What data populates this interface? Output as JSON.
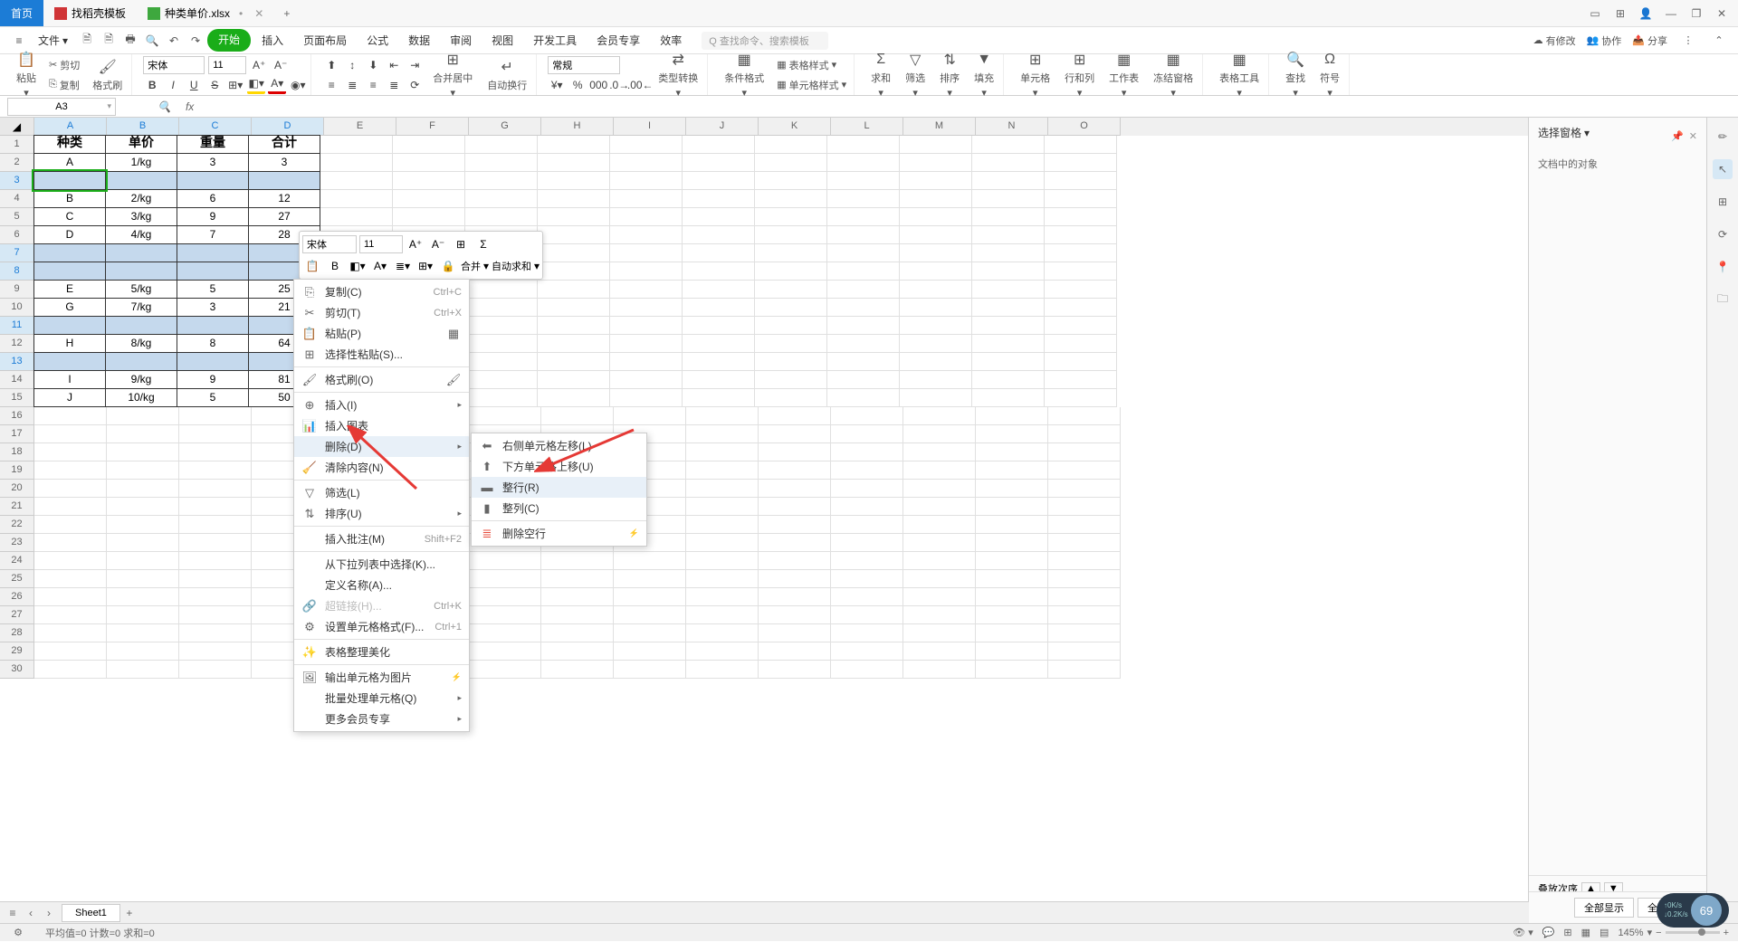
{
  "tabs": {
    "home": "首页",
    "templates": "找稻壳模板",
    "file": "种类单价.xlsx"
  },
  "menu": {
    "file": "文件",
    "items": [
      "开始",
      "插入",
      "页面布局",
      "公式",
      "数据",
      "审阅",
      "视图",
      "开发工具",
      "会员专享",
      "效率"
    ],
    "search": "Q 查找命令、搜索模板"
  },
  "right_tools": {
    "modified": "有修改",
    "collaborate": "协作",
    "share": "分享"
  },
  "ribbon": {
    "paste": "粘贴",
    "cut": "剪切",
    "copy": "复制",
    "format_painter": "格式刷",
    "font_name": "宋体",
    "font_size": "11",
    "merge_center": "合并居中",
    "wrap": "自动换行",
    "number_format": "常规",
    "type_convert": "类型转换",
    "cond_format": "条件格式",
    "table_format": "表格样式",
    "cell_format": "单元格样式",
    "sum": "求和",
    "filter": "筛选",
    "sort": "排序",
    "fill": "填充",
    "cell": "单元格",
    "rows_cols": "行和列",
    "sheet": "工作表",
    "freeze": "冻结窗格",
    "table_tools": "表格工具",
    "find": "查找",
    "symbol": "符号"
  },
  "name_box": "A3",
  "columns": [
    "A",
    "B",
    "C",
    "D",
    "E",
    "F",
    "G",
    "H",
    "I",
    "J",
    "K",
    "L",
    "M",
    "N",
    "O"
  ],
  "table": {
    "headers": [
      "种类",
      "单价",
      "重量",
      "合计"
    ],
    "rows": [
      [
        "A",
        "1/kg",
        "3",
        "3"
      ],
      [
        "",
        "",
        "",
        ""
      ],
      [
        "B",
        "2/kg",
        "6",
        "12"
      ],
      [
        "C",
        "3/kg",
        "9",
        "27"
      ],
      [
        "D",
        "4/kg",
        "7",
        "28"
      ],
      [
        "",
        "",
        "",
        ""
      ],
      [
        "",
        "",
        "",
        ""
      ],
      [
        "E",
        "5/kg",
        "5",
        "25"
      ],
      [
        "G",
        "7/kg",
        "3",
        "21"
      ],
      [
        "",
        "",
        "",
        ""
      ],
      [
        "H",
        "8/kg",
        "8",
        "64"
      ],
      [
        "",
        "",
        "",
        ""
      ],
      [
        "I",
        "9/kg",
        "9",
        "81"
      ],
      [
        "J",
        "10/kg",
        "5",
        "50"
      ]
    ]
  },
  "float_tb": {
    "font": "宋体",
    "size": "11",
    "merge": "合并",
    "sum": "自动求和"
  },
  "context_menu": {
    "copy": "复制(C)",
    "cut": "剪切(T)",
    "paste": "粘贴(P)",
    "paste_special": "选择性粘贴(S)...",
    "format_painter": "格式刷(O)",
    "insert": "插入(I)",
    "insert_chart": "插入图表",
    "delete": "删除(D)",
    "clear": "清除内容(N)",
    "filter": "筛选(L)",
    "sort": "排序(U)",
    "insert_comment": "插入批注(M)",
    "from_dropdown": "从下拉列表中选择(K)...",
    "define_name": "定义名称(A)...",
    "hyperlink": "超链接(H)...",
    "cell_format": "设置单元格格式(F)...",
    "format_beautify": "表格整理美化",
    "export_image": "输出单元格为图片",
    "batch_process": "批量处理单元格(Q)",
    "more_member": "更多会员专享",
    "sc_copy": "Ctrl+C",
    "sc_cut": "Ctrl+X",
    "sc_comment": "Shift+F2",
    "sc_hyper": "Ctrl+K",
    "sc_format": "Ctrl+1"
  },
  "delete_submenu": {
    "shift_left": "右侧单元格左移(L)",
    "shift_up": "下方单元格上移(U)",
    "entire_row": "整行(R)",
    "entire_col": "整列(C)",
    "delete_blank": "删除空行"
  },
  "side_panel": {
    "title": "选择窗格",
    "content": "文档中的对象",
    "stack": "叠放次序",
    "show_all": "全部显示",
    "hide_all": "全部隐藏"
  },
  "sheet_tabs": {
    "sheet1": "Sheet1"
  },
  "status": {
    "stats": "平均值=0  计数=0  求和=0",
    "zoom": "145%"
  },
  "sys_widget": {
    "speed1": "0K/s",
    "speed2": "0.2K/s",
    "percent": "69"
  }
}
